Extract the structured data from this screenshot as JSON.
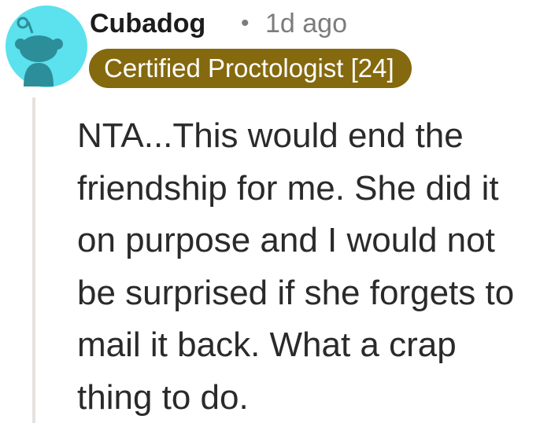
{
  "comment": {
    "author": "Cubadog",
    "separator": "•",
    "timestamp": "1d ago",
    "flair": "Certified Proctologist [24]",
    "body_lines": [
      "NTA...This would end the",
      "friendship for me. She did it",
      "on purpose and I would not",
      "be surprised if she forgets to",
      "mail it back. What a crap",
      "thing to do."
    ],
    "avatar_icon": "reddit-snoo-avatar-icon"
  },
  "colors": {
    "avatar_bg": "#5ce1ee",
    "avatar_figure": "#2c8e99",
    "flair_bg": "#84690e",
    "flair_text": "#ffffff",
    "meta_text": "#7c7c7c",
    "thread_line": "#e5e2dd"
  }
}
